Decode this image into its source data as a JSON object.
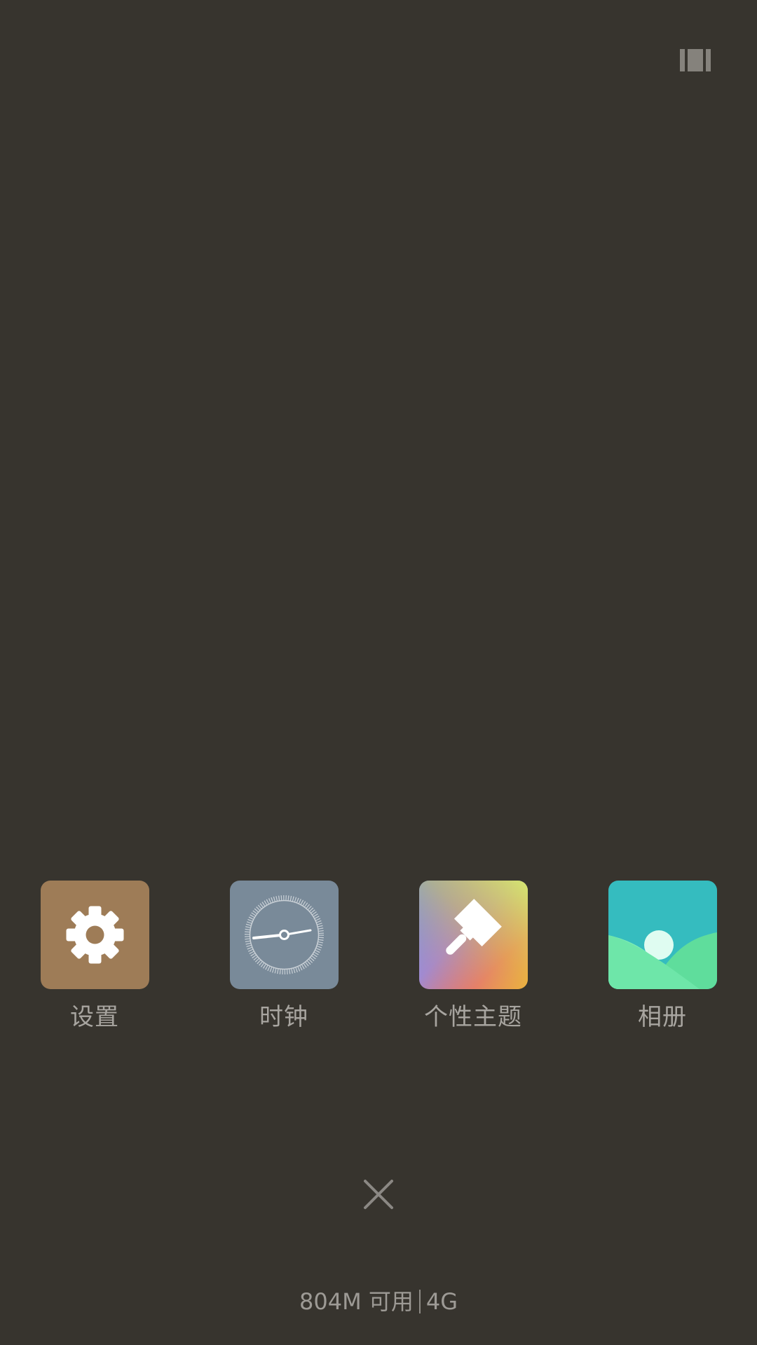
{
  "colors": {
    "background": "#37342e",
    "label": "#a8a5a0",
    "settings_tile": "#9e7c57",
    "clock_tile": "#798a99",
    "gallery_sky": "#35bcbf",
    "gallery_grass": "#6ee6a9"
  },
  "dock": {
    "apps": [
      {
        "name": "设置",
        "icon": "gear-icon"
      },
      {
        "name": "时钟",
        "icon": "clock-icon"
      },
      {
        "name": "个性主题",
        "icon": "paintbrush-icon"
      },
      {
        "name": "相册",
        "icon": "gallery-icon"
      }
    ]
  },
  "controls": {
    "view_toggle_icon": "view-toggle-icon",
    "close_icon": "close-icon"
  },
  "status": {
    "memory_available": "804M 可用",
    "network": "4G"
  }
}
